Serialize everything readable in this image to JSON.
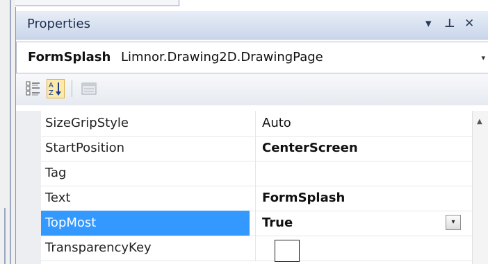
{
  "panel": {
    "title": "Properties",
    "buttons": {
      "dropdown_glyph": "▾",
      "pin_glyph": "⊥",
      "close_glyph": "✕"
    }
  },
  "selector": {
    "object_name": "FormSplash",
    "object_type": "Limnor.Drawing2D.DrawingPage",
    "arrow_glyph": "▾"
  },
  "toolbar": {
    "categorized_icon": "categorized-icon",
    "alphabetical_icon": "alphabetical-sort-icon",
    "property_pages_icon": "property-pages-icon"
  },
  "grid": {
    "rows": [
      {
        "name": "SizeGripStyle",
        "value": "Auto",
        "bold": false
      },
      {
        "name": "StartPosition",
        "value": "CenterScreen",
        "bold": true
      },
      {
        "name": "Tag",
        "value": "",
        "bold": false
      },
      {
        "name": "Text",
        "value": "FormSplash",
        "bold": true
      },
      {
        "name": "TopMost",
        "value": "True",
        "bold": true,
        "selected": true
      },
      {
        "name": "TransparencyKey",
        "value": "",
        "bold": false,
        "color_swatch": "#ffffff"
      }
    ],
    "combo_glyph": "▾",
    "scroll_up_glyph": "▲"
  },
  "colors": {
    "selection": "#3399ff",
    "title_gradient_top": "#e8eef8",
    "title_gradient_bottom": "#c9d6ea",
    "alpha_button_highlight": "#fde9a8"
  }
}
